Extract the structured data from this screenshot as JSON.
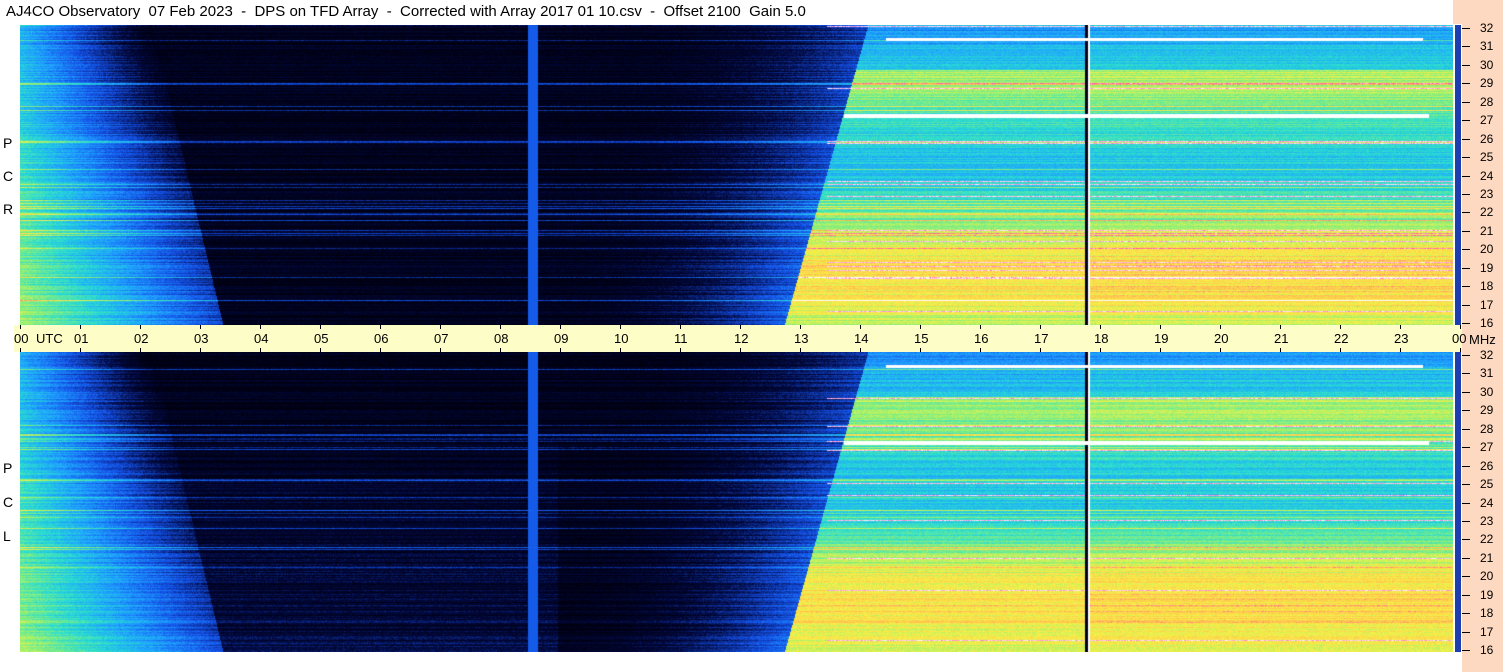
{
  "title": "AJ4CO Observatory  07 Feb 2023  -  DPS on TFD Array  -  Corrected with Array 2017 01 10.csv  -  Offset 2100  Gain 5.0",
  "panels": [
    {
      "id": "rcp",
      "letters": [
        "P",
        "C",
        "R"
      ]
    },
    {
      "id": "lcp",
      "letters": [
        "P",
        "C",
        "L"
      ]
    }
  ],
  "time_axis": {
    "labels": [
      "00",
      "01",
      "02",
      "03",
      "04",
      "05",
      "06",
      "07",
      "08",
      "09",
      "10",
      "11",
      "12",
      "13",
      "14",
      "15",
      "16",
      "17",
      "18",
      "19",
      "20",
      "21",
      "22",
      "23",
      "00"
    ],
    "utc_label": "UTC",
    "unit_right": "MHz"
  },
  "freq_axis": {
    "labels": [
      "32",
      "31",
      "30",
      "29",
      "28",
      "27",
      "26",
      "25",
      "24",
      "23",
      "22",
      "21",
      "20",
      "19",
      "18",
      "17",
      "16"
    ]
  },
  "chart_data": {
    "type": "heatmap",
    "title": "AJ4CO Observatory  07 Feb 2023  -  DPS on TFD Array  -  Corrected with Array 2017 01 10.csv  -  Offset 2100  Gain 5.0",
    "x_unit": "UTC hours",
    "y_unit": "MHz",
    "xlim": [
      0,
      24
    ],
    "ylim": [
      16,
      32
    ],
    "series": [
      {
        "name": "RCP",
        "daytime_high_intensity_start_hour": 13.5,
        "night_low_intensity_hours": [
          3,
          13
        ]
      },
      {
        "name": "LCP",
        "daytime_high_intensity_start_hour": 13.5,
        "night_low_intensity_hours": [
          3,
          13
        ]
      }
    ],
    "colors": {
      "low": "#000010",
      "mid": "#1e64ff",
      "high": "#ffe840",
      "peak": "#ff40c0",
      "sat": "#ffffff"
    }
  }
}
